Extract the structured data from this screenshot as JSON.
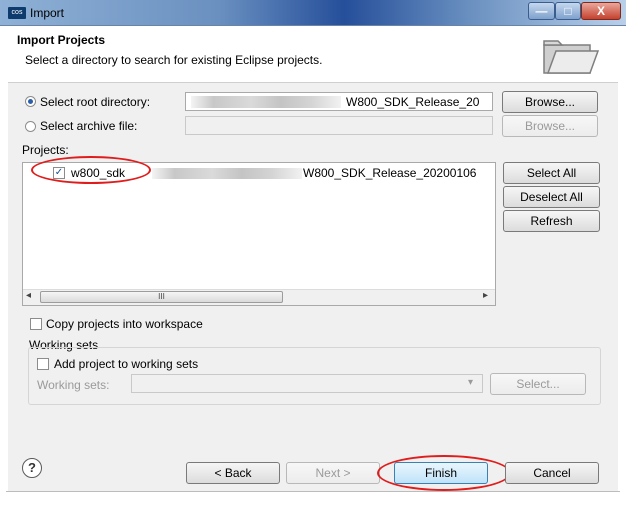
{
  "window": {
    "title": "Import",
    "app_icon_text": "cos"
  },
  "header": {
    "title": "Import Projects",
    "subtitle": "Select a directory to search for existing Eclipse projects."
  },
  "root_directory": {
    "label": "Select root directory:",
    "value": "W800_SDK_Release_20",
    "selected": true,
    "browse_label": "Browse..."
  },
  "archive_file": {
    "label": "Select archive file:",
    "value": "",
    "selected": false,
    "browse_label": "Browse..."
  },
  "projects": {
    "label": "Projects:",
    "items": [
      {
        "name": "w800_sdk",
        "path": "W800_SDK_Release_20200106",
        "checked": true
      }
    ],
    "scroll_thumb_glyph": "III",
    "scroll_left_glyph": "◂",
    "scroll_right_glyph": "▸"
  },
  "side_buttons": {
    "select_all": "Select All",
    "deselect_all": "Deselect All",
    "refresh": "Refresh"
  },
  "options": {
    "copy_into_workspace": "Copy projects into workspace",
    "copy_checked": false
  },
  "working_sets": {
    "group_label": "Working sets",
    "add_label": "Add project to working sets",
    "add_checked": false,
    "field_label": "Working sets:",
    "select_label": "Select...",
    "dropdown_glyph": "▾"
  },
  "footer": {
    "help_glyph": "?",
    "back": "< Back",
    "next": "Next >",
    "finish": "Finish",
    "cancel": "Cancel"
  },
  "window_controls": {
    "minimize": "—",
    "maximize": "□",
    "close": "X"
  },
  "colors": {
    "annotation_red": "#e01c1c",
    "title_bar_blue": "#254f9a",
    "primary_button": "#bfe3f9"
  }
}
